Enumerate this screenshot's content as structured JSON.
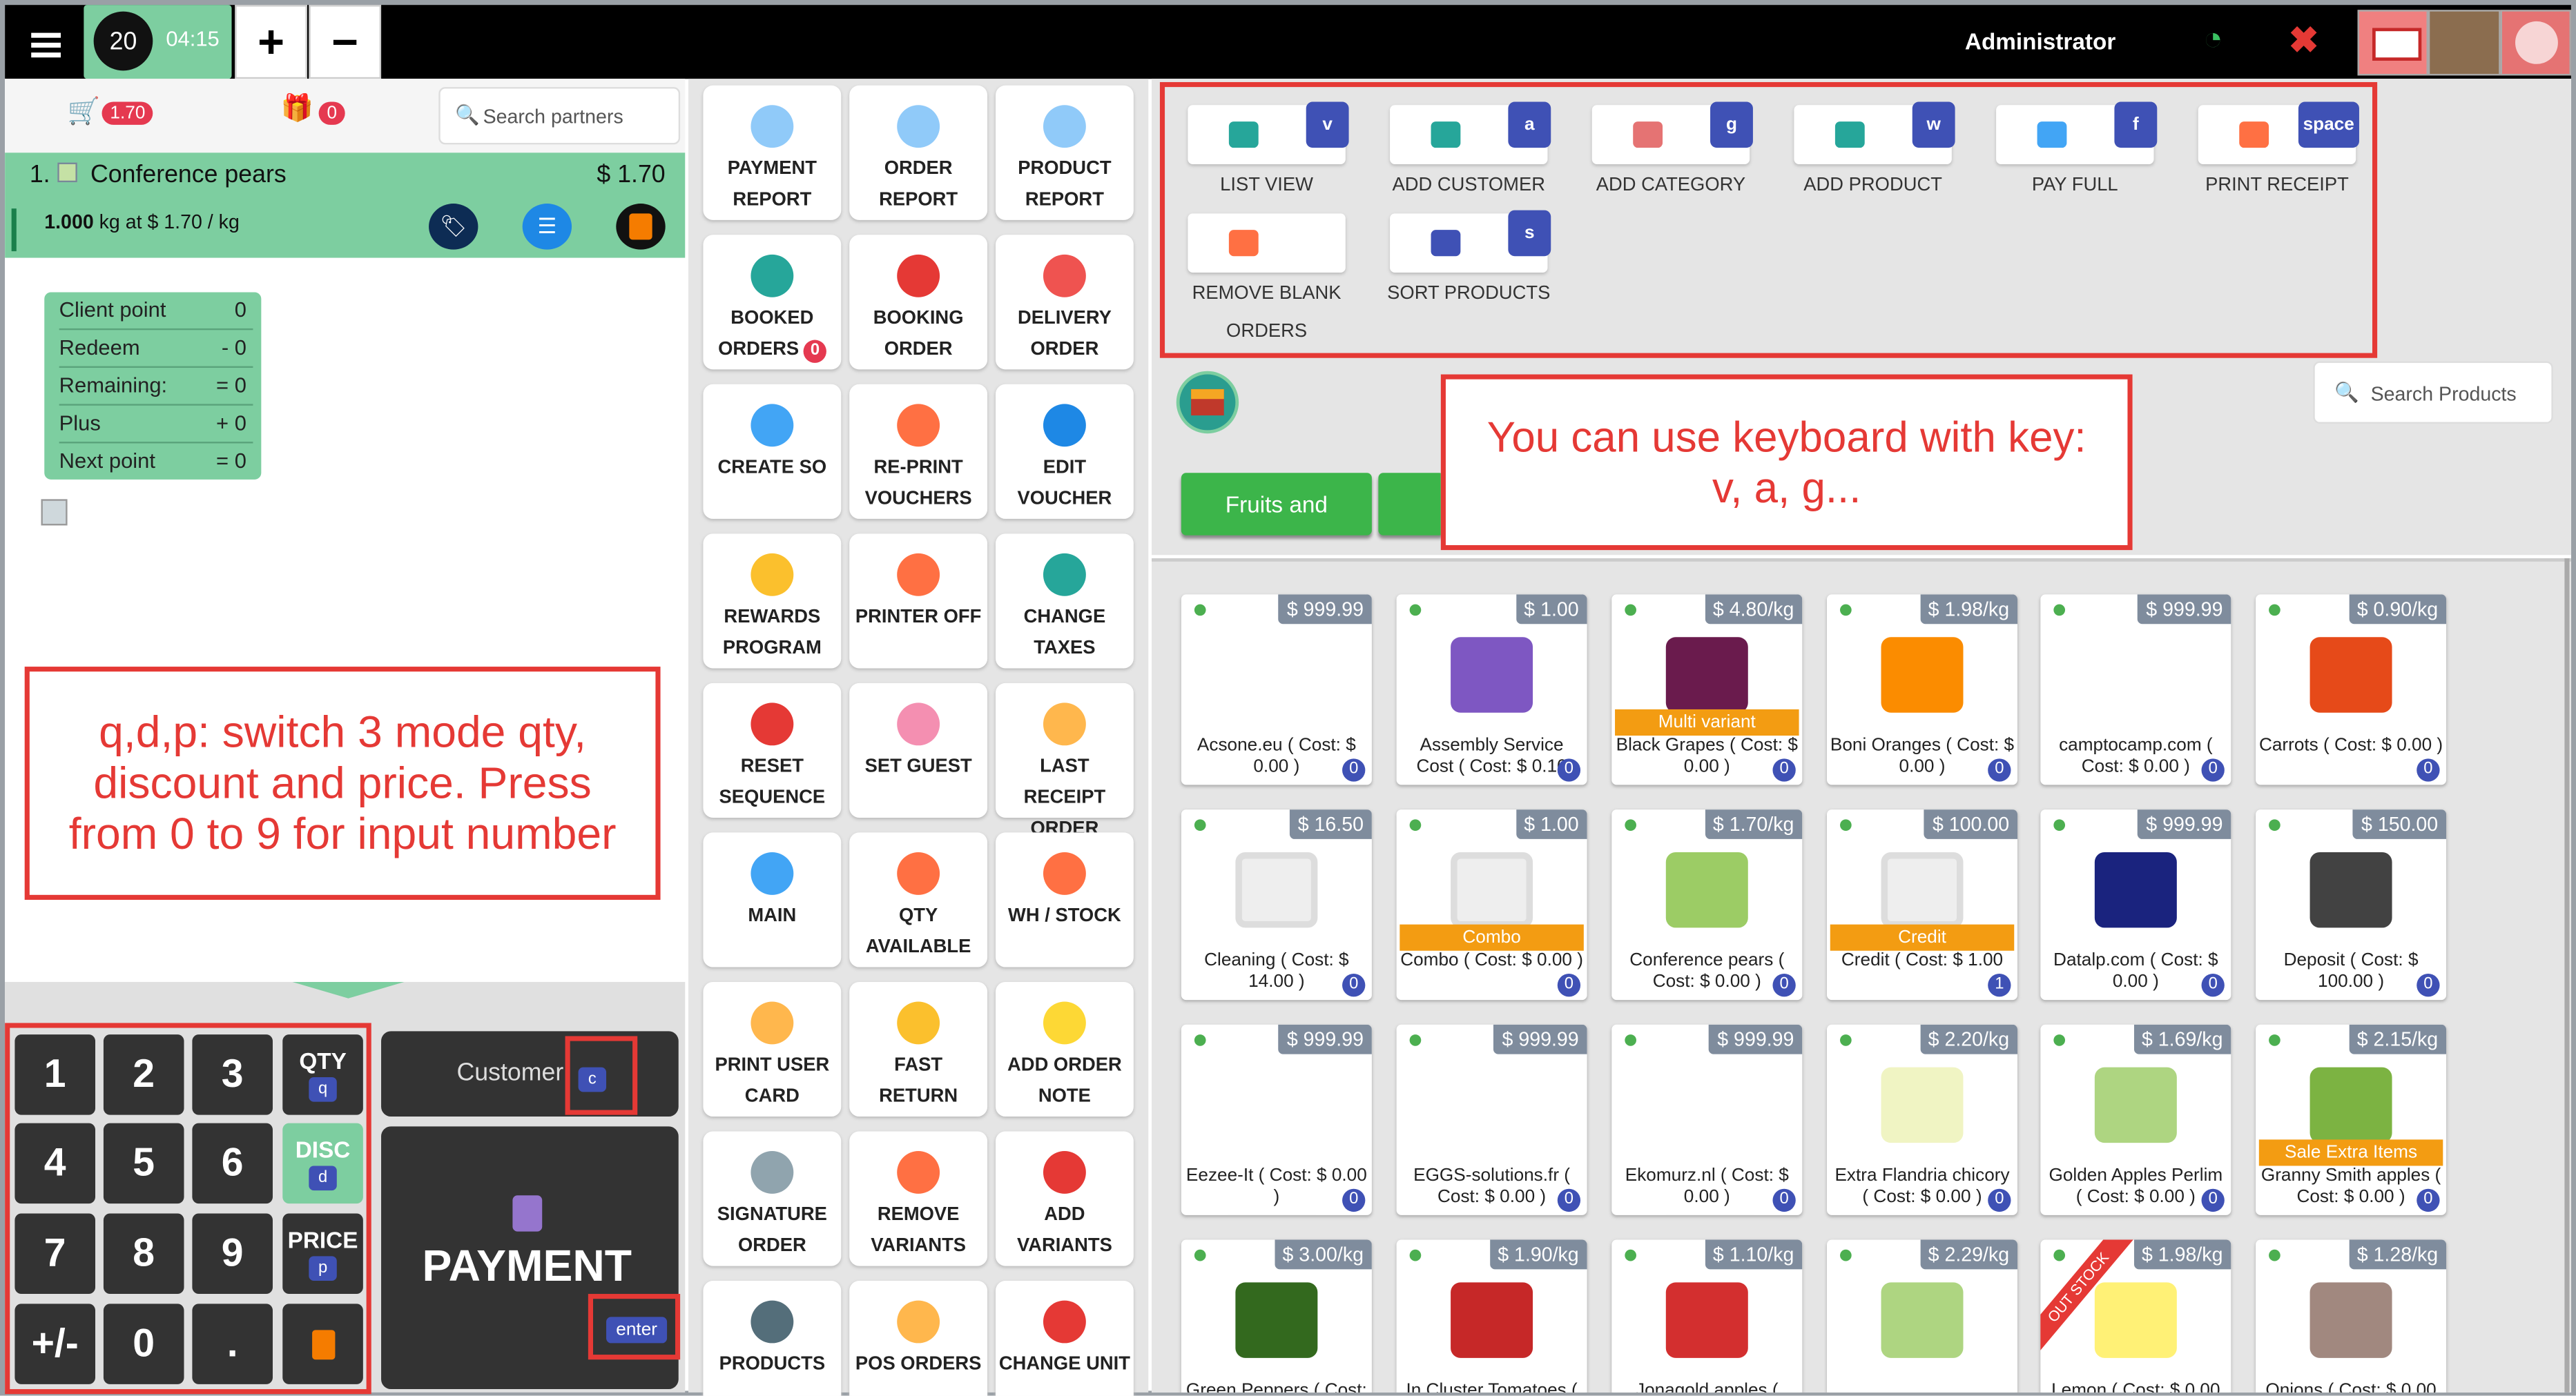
{
  "header": {
    "session_number": "20",
    "time": "04:15",
    "plus_label": "+",
    "minus_label": "−",
    "user": "Administrator",
    "wifi_icon": "wifi-icon",
    "close_icon": "close-icon"
  },
  "left": {
    "cart_amount": "1.70",
    "gift_count": "0",
    "search_placeholder": "Search partners",
    "order_line": {
      "index": "1.",
      "name": "Conference pears",
      "price": "$ 1.70",
      "qty_bold": "1.000",
      "qty_rest": " kg at $ 1.70 / kg"
    },
    "points": [
      {
        "label": "Client point",
        "value": "0"
      },
      {
        "label": "Redeem",
        "value": "- 0"
      },
      {
        "label": "Remaining:",
        "value": "= 0"
      },
      {
        "label": "Plus",
        "value": "+ 0"
      },
      {
        "label": "Next point",
        "value": "= 0"
      }
    ],
    "note_text": "q,d,p: switch 3 mode qty, discount and price. Press from 0 to 9 for input number"
  },
  "numpad": {
    "keys": [
      "1",
      "2",
      "3",
      "4",
      "5",
      "6",
      "7",
      "8",
      "9",
      "+/-",
      "0",
      "."
    ],
    "qty_label": "QTY",
    "qty_key": "q",
    "disc_label": "DISC",
    "disc_key": "d",
    "price_label": "PRICE",
    "price_key": "p",
    "customer_label": "Customer",
    "customer_key": "c",
    "payment_label": "PAYMENT",
    "payment_key": "enter"
  },
  "middle_tiles": [
    {
      "label": "PAYMENT REPORT",
      "icon": "chart-icon",
      "color": "#90caf9"
    },
    {
      "label": "ORDER REPORT",
      "icon": "chart-icon",
      "color": "#90caf9"
    },
    {
      "label": "PRODUCT REPORT",
      "icon": "chart-icon",
      "color": "#90caf9"
    },
    {
      "label": "BOOKED ORDERS",
      "badge": "0",
      "icon": "booked-icon",
      "color": "#26a69a"
    },
    {
      "label": "BOOKING ORDER",
      "icon": "headset-icon",
      "color": "#e53935"
    },
    {
      "label": "DELIVERY ORDER",
      "icon": "delivery-icon",
      "color": "#ef5350"
    },
    {
      "label": "CREATE SO",
      "icon": "cart-icon",
      "color": "#42a5f5"
    },
    {
      "label": "RE-PRINT VOUCHERS",
      "icon": "printer-icon",
      "color": "#ff7043"
    },
    {
      "label": "EDIT VOUCHER",
      "icon": "voucher-icon",
      "color": "#1e88e5"
    },
    {
      "label": "REWARDS PROGRAM",
      "icon": "medal-icon",
      "color": "#fbc02d"
    },
    {
      "label": "PRINTER OFF",
      "icon": "printer-icon",
      "color": "#ff7043"
    },
    {
      "label": "CHANGE TAXES",
      "icon": "tax-icon",
      "color": "#26a69a"
    },
    {
      "label": "RESET SEQUENCE",
      "icon": "power-icon",
      "color": "#e53935"
    },
    {
      "label": "SET GUEST",
      "icon": "guest-icon",
      "color": "#f48fb1"
    },
    {
      "label": "LAST RECEIPT ORDER",
      "icon": "register-icon",
      "color": "#ffb74d"
    },
    {
      "label": "MAIN",
      "icon": "team-icon",
      "color": "#42a5f5"
    },
    {
      "label": "QTY AVAILABLE",
      "icon": "warehouse-icon",
      "color": "#ff7043"
    },
    {
      "label": "WH / STOCK",
      "icon": "warehouse-icon",
      "color": "#ff7043"
    },
    {
      "label": "PRINT USER CARD",
      "icon": "id-card-icon",
      "color": "#ffb74d"
    },
    {
      "label": "FAST RETURN",
      "icon": "dollar-icon",
      "color": "#fbc02d"
    },
    {
      "label": "ADD ORDER NOTE",
      "icon": "note-icon",
      "color": "#fdd835"
    },
    {
      "label": "SIGNATURE ORDER",
      "icon": "signature-icon",
      "color": "#90a4ae"
    },
    {
      "label": "REMOVE VARIANTS",
      "icon": "trash-icon",
      "color": "#ff7043"
    },
    {
      "label": "ADD VARIANTS",
      "icon": "variant-icon",
      "color": "#e53935"
    },
    {
      "label": "PRODUCTS",
      "icon": "barcode-icon",
      "color": "#546e7a"
    },
    {
      "label": "POS ORDERS",
      "icon": "search-doc-icon",
      "color": "#ffb74d"
    },
    {
      "label": "CHANGE UNIT",
      "icon": "unit-icon",
      "color": "#e53935"
    }
  ],
  "shortcuts": [
    {
      "label": "LIST VIEW",
      "key": "v",
      "icon": "list-icon",
      "color": "#26a69a"
    },
    {
      "label": "ADD CUSTOMER",
      "key": "a",
      "icon": "user-icon",
      "color": "#26a69a"
    },
    {
      "label": "ADD CATEGORY",
      "key": "g",
      "icon": "tree-icon",
      "color": "#e57373"
    },
    {
      "label": "ADD PRODUCT",
      "key": "w",
      "icon": "product-icon",
      "color": "#26a69a"
    },
    {
      "label": "PAY FULL",
      "key": "f",
      "icon": "card-icon",
      "color": "#42a5f5"
    },
    {
      "label": "PRINT RECEIPT",
      "key": "space",
      "icon": "printer-icon",
      "color": "#ff7043"
    },
    {
      "label": "REMOVE BLANK ORDERS",
      "key": "",
      "icon": "trash-icon",
      "color": "#ff7043"
    },
    {
      "label": "SORT PRODUCTS",
      "key": "s",
      "icon": "sort-icon",
      "color": "#3f51b5"
    }
  ],
  "keyboard_note": "You can use keyboard with key: v, a, g...",
  "search_products_placeholder": "Search Products",
  "categories": [
    "Fruits and",
    ""
  ],
  "products": [
    {
      "price": "$ 999.99",
      "name": "Acsone.eu ( Cost: $ 0.00 )",
      "count": "0",
      "color": "#ffffff",
      "logo": "acsone"
    },
    {
      "price": "$ 1.00",
      "name": "Assembly Service Cost ( Cost: $ 0.10",
      "count": "0",
      "color": "#7e57c2"
    },
    {
      "price": "$ 4.80/kg",
      "name": "Black Grapes ( Cost: $ 0.00 )",
      "count": "0",
      "color": "#6a1b4d",
      "tag": "Multi variant"
    },
    {
      "price": "$ 1.98/kg",
      "name": "Boni Oranges ( Cost: $ 0.00 )",
      "count": "0",
      "color": "#fb8c00"
    },
    {
      "price": "$ 999.99",
      "name": "camptocamp.com ( Cost: $ 0.00 )",
      "count": "0",
      "color": "#ffffff",
      "logo": "camptocamp"
    },
    {
      "price": "$ 0.90/kg",
      "name": "Carrots ( Cost: $ 0.00 )",
      "count": "0",
      "color": "#e64a19"
    },
    {
      "price": "$ 16.50",
      "name": "Cleaning ( Cost: $ 14.00 )",
      "count": "0",
      "color": "#eeeeee"
    },
    {
      "price": "$ 1.00",
      "name": "Combo ( Cost: $ 0.00 )",
      "count": "0",
      "color": "#eeeeee",
      "tag": "Combo"
    },
    {
      "price": "$ 1.70/kg",
      "name": "Conference pears ( Cost: $ 0.00 )",
      "count": "0",
      "color": "#9ccc65"
    },
    {
      "price": "$ 100.00",
      "name": "Credit ( Cost: $ 1.00",
      "count": "1",
      "color": "#eeeeee",
      "tag": "Credit"
    },
    {
      "price": "$ 999.99",
      "name": "Datalp.com ( Cost: $ 0.00 )",
      "count": "0",
      "color": "#1a237e"
    },
    {
      "price": "$ 150.00",
      "name": "Deposit ( Cost: $ 100.00 )",
      "count": "0",
      "color": "#424242"
    },
    {
      "price": "$ 999.99",
      "name": "Eezee-It ( Cost: $ 0.00 )",
      "count": "0",
      "color": "#ffffff",
      "logo": "eezee"
    },
    {
      "price": "$ 999.99",
      "name": "EGGS-solutions.fr ( Cost: $ 0.00 )",
      "count": "0",
      "color": "#ffffff",
      "logo": "eggs"
    },
    {
      "price": "$ 999.99",
      "name": "Ekomurz.nl ( Cost: $ 0.00 )",
      "count": "0",
      "color": "#ffffff",
      "logo": "ekomurz"
    },
    {
      "price": "$ 2.20/kg",
      "name": "Extra Flandria chicory ( Cost: $ 0.00 )",
      "count": "0",
      "color": "#f0f4c3"
    },
    {
      "price": "$ 1.69/kg",
      "name": "Golden Apples Perlim ( Cost: $ 0.00 )",
      "count": "0",
      "color": "#aed581"
    },
    {
      "price": "$ 2.15/kg",
      "name": "Granny Smith apples ( Cost: $ 0.00 )",
      "count": "0",
      "color": "#7cb342",
      "tag": "Sale Extra Items"
    },
    {
      "price": "$ 3.00/kg",
      "name": "Green Peppers ( Cost:",
      "count": "",
      "color": "#33691e"
    },
    {
      "price": "$ 1.90/kg",
      "name": "In Cluster Tomatoes (",
      "count": "",
      "color": "#c62828"
    },
    {
      "price": "$ 1.10/kg",
      "name": "Jonagold apples (",
      "count": "",
      "color": "#d32f2f"
    },
    {
      "price": "$ 2.29/kg",
      "name": "",
      "count": "",
      "color": "#aed581"
    },
    {
      "price": "$ 1.98/kg",
      "name": "Lemon ( Cost: $ 0.00",
      "count": "",
      "color": "#fff176",
      "ribbon": "OUT STOCK"
    },
    {
      "price": "$ 1.28/kg",
      "name": "Onions ( Cost: $ 0.00",
      "count": "",
      "color": "#a1887f"
    }
  ]
}
